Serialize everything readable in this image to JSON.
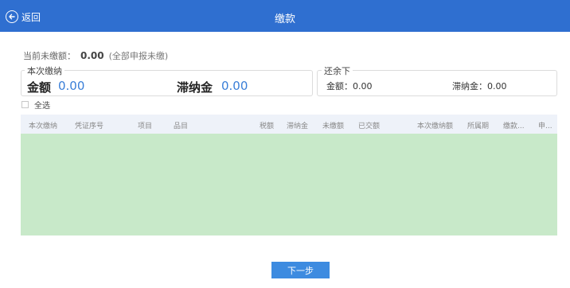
{
  "header": {
    "back_label": "返回",
    "title": "缴款"
  },
  "summary": {
    "unpaid_label": "当前未缴额：",
    "unpaid_amount": "0.00",
    "unpaid_note": "(全部申报未缴)"
  },
  "pay_box": {
    "legend": "本次缴纳",
    "amount_label": "金额",
    "amount_value": "0.00",
    "late_fee_label": "滞纳金",
    "late_fee_value": "0.00"
  },
  "remain_box": {
    "legend": "还余下",
    "amount": "金额：0.00",
    "late_fee": "滞纳金：0.00"
  },
  "select_all_label": "全选",
  "table": {
    "columns": [
      "本次缴纳",
      "凭证序号",
      "项目",
      "品目",
      "税额",
      "滞纳金",
      "未缴额",
      "已交额",
      "本次缴纳额",
      "所属期",
      "缴款...",
      "申..."
    ],
    "rows": []
  },
  "footer": {
    "next_label": "下一步"
  },
  "colors": {
    "header_bg": "#2f6fd0",
    "accent_value": "#3a7fd8",
    "table_body_bg": "#c8e9c9",
    "button_bg": "#3d8be0"
  }
}
